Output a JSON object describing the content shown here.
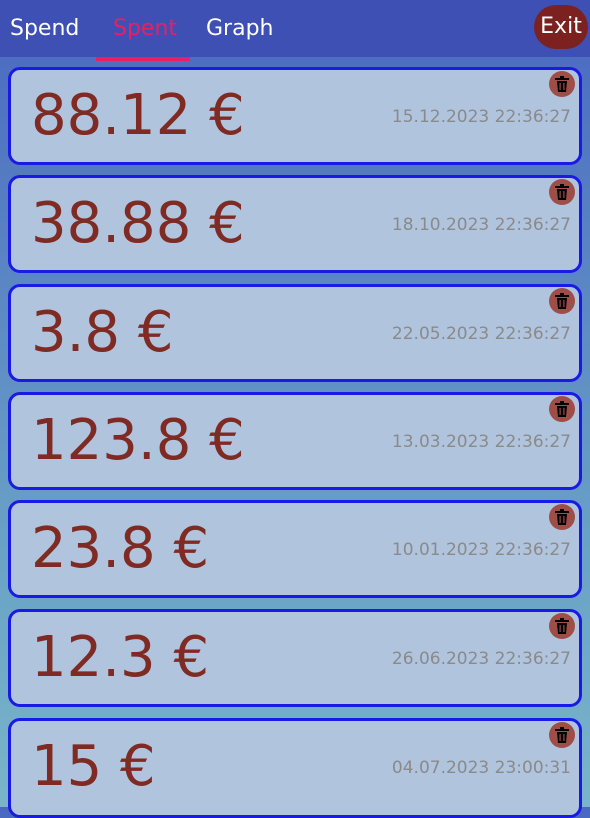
{
  "tabs": [
    {
      "label": "Spend",
      "active": false
    },
    {
      "label": "Spent",
      "active": true
    },
    {
      "label": "Graph",
      "active": false
    }
  ],
  "exit_label": "Exit",
  "colors": {
    "header": "#3e50b4",
    "active_tab": "#e91e63",
    "amount_text": "#7f2a22",
    "card_background": "#b0c4de",
    "card_border": "#1a1ae6",
    "exit_button": "#7b2220",
    "delete_button": "#9e4d47"
  },
  "delete_icon": "trash-icon",
  "expenses": [
    {
      "amount": "88.12 €",
      "timestamp": "15.12.2023 22:36:27"
    },
    {
      "amount": "38.88 €",
      "timestamp": "18.10.2023 22:36:27"
    },
    {
      "amount": "3.8 €",
      "timestamp": "22.05.2023 22:36:27"
    },
    {
      "amount": "123.8 €",
      "timestamp": "13.03.2023 22:36:27"
    },
    {
      "amount": "23.8 €",
      "timestamp": "10.01.2023 22:36:27"
    },
    {
      "amount": "12.3 €",
      "timestamp": "26.06.2023 22:36:27"
    },
    {
      "amount": "15 €",
      "timestamp": "04.07.2023 23:00:31"
    }
  ]
}
